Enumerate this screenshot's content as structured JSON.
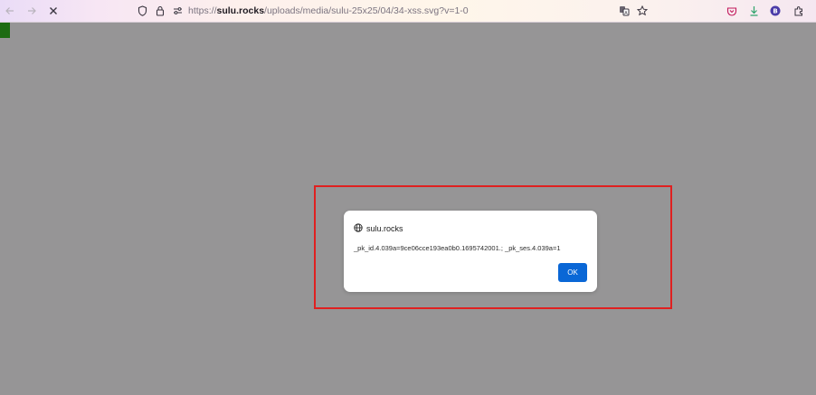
{
  "browser": {
    "url": {
      "scheme": "https://",
      "host": "sulu.rocks",
      "path": "/uploads/media/sulu-25x25/04/34-xss.svg?v=1-0"
    },
    "icons": {
      "back": "back-arrow-icon",
      "forward": "forward-arrow-icon",
      "stop": "stop-icon",
      "shield": "shield-icon",
      "lock": "lock-icon",
      "permissions": "permissions-icon",
      "translate": "translate-icon",
      "bookmark": "bookmark-star-icon",
      "pocket": "pocket-icon",
      "downloads": "download-icon",
      "extension": "extension-icon",
      "extension_badge": "B",
      "extensions": "extensions-puzzle-icon"
    }
  },
  "colors": {
    "page_background": "#969596",
    "highlight_border": "#e02020",
    "ok_button": "#0a67d6",
    "side_tab": "#1d6b12"
  },
  "alert": {
    "site": "sulu.rocks",
    "message": "_pk_id.4.039a=9ce06cce193ea0b0.1695742001.; _pk_ses.4.039a=1",
    "ok_label": "OK"
  }
}
